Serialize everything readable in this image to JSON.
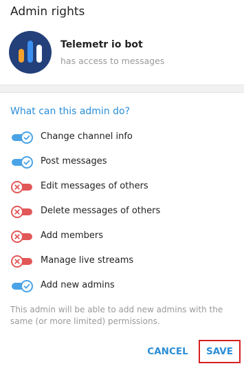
{
  "dialog": {
    "title": "Admin rights"
  },
  "bot": {
    "name": "Telemetr io bot",
    "status": "has access to messages"
  },
  "permissions": {
    "section_title": "What can this admin do?",
    "items": [
      {
        "label": "Change channel info",
        "enabled": true
      },
      {
        "label": "Post messages",
        "enabled": true
      },
      {
        "label": "Edit messages of others",
        "enabled": false
      },
      {
        "label": "Delete messages of others",
        "enabled": false
      },
      {
        "label": "Add members",
        "enabled": false
      },
      {
        "label": "Manage live streams",
        "enabled": false
      },
      {
        "label": "Add new admins",
        "enabled": true
      }
    ],
    "hint": "This admin will be able to add new admins with the same (or more limited) permissions."
  },
  "buttons": {
    "cancel_label": "CANCEL",
    "save_label": "SAVE"
  },
  "colors": {
    "accent": "#2b8ed6",
    "toggle_on": "#4aa3e6",
    "toggle_off": "#e25858",
    "highlight_border": "#d42020"
  }
}
